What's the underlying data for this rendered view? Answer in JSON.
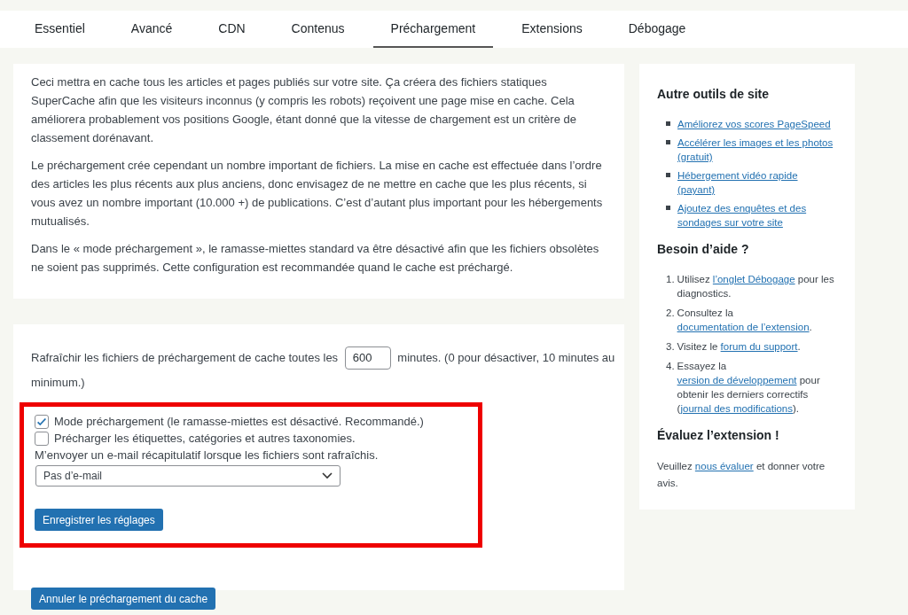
{
  "tabs": [
    {
      "label": "Essentiel",
      "selected": false
    },
    {
      "label": "Avancé",
      "selected": false
    },
    {
      "label": "CDN",
      "selected": false
    },
    {
      "label": "Contenus",
      "selected": false
    },
    {
      "label": "Préchargement",
      "selected": true
    },
    {
      "label": "Extensions",
      "selected": false
    },
    {
      "label": "Débogage",
      "selected": false
    }
  ],
  "intro": [
    "Ceci mettra en cache tous les articles et pages publiés sur votre site. Ça créera des fichiers statiques SuperCache afin que les visiteurs inconnus (y compris les robots) reçoivent une page mise en cache. Cela améliorera probablement vos positions Google, étant donné que la vitesse de chargement est un critère de classement dorénavant.",
    "Le préchargement crée cependant un nombre important de fichiers. La mise en cache est effectuée dans l’ordre des articles les plus récents aux plus anciens, donc envisagez de ne mettre en cache que les plus récents, si vous avez un nombre important (10.000 +) de publications. C’est d’autant plus important pour les hébergements mutualisés.",
    "Dans le « mode préchargement », le ramasse-miettes standard va être désactivé afin que les fichiers obsolètes ne soient pas supprimés. Cette configuration est recommandée quand le cache est préchargé."
  ],
  "settings": {
    "refresh_before": "Rafraîchir les fichiers de préchargement de cache toutes les",
    "refresh_value": "600",
    "refresh_after": "minutes. (0 pour désactiver, 10 minutes au minimum.)",
    "checkboxes": [
      {
        "label": "Mode préchargement (le ramasse-miettes est désactivé. Recommandé.)",
        "checked": true
      },
      {
        "label": "Précharger les étiquettes, catégories et autres taxonomies.",
        "checked": false
      }
    ],
    "email_label": "M’envoyer un e-mail récapitulatif lorsque les fichiers sont rafraîchis.",
    "email_select": "Pas d’e-mail",
    "save_button": "Enregistrer les réglages",
    "cancel_button": "Annuler le préchargement du cache"
  },
  "sidebar": {
    "tools_title": "Autre outils de site",
    "tools": [
      "Améliorez vos scores PageSpeed",
      "Accélérer les images et les photos (gratuit)",
      "Hébergement vidéo rapide (payant)",
      "Ajoutez des enquêtes et des sondages sur votre site"
    ],
    "help_title": "Besoin d’aide ?",
    "help": [
      {
        "number": "1.",
        "parts": [
          {
            "text": "Utilisez ",
            "link": false
          },
          {
            "text": "l’onglet Débogage",
            "link": true
          },
          {
            "text": " pour les diagnostics.",
            "link": false
          }
        ]
      },
      {
        "number": "2.",
        "parts": [
          {
            "text": "Consultez la ",
            "link": false
          },
          {
            "text": "documentation de l’extension",
            "link": true
          },
          {
            "text": ".",
            "link": false
          }
        ]
      },
      {
        "number": "3.",
        "parts": [
          {
            "text": "Visitez le ",
            "link": false
          },
          {
            "text": "forum du support",
            "link": true
          },
          {
            "text": ".",
            "link": false
          }
        ]
      },
      {
        "number": "4.",
        "parts": [
          {
            "text": "Essayez la ",
            "link": false
          },
          {
            "text": "version de développement",
            "link": true
          },
          {
            "text": " pour obtenir les derniers correctifs (",
            "link": false
          },
          {
            "text": "journal des modifications",
            "link": true
          },
          {
            "text": ").",
            "link": false
          }
        ]
      }
    ],
    "rate_title": "Évaluez l’extension !",
    "rate": [
      {
        "text": "Veuillez ",
        "link": false
      },
      {
        "text": "nous évaluer",
        "link": true
      },
      {
        "text": " et donner votre avis.",
        "link": false
      }
    ]
  }
}
